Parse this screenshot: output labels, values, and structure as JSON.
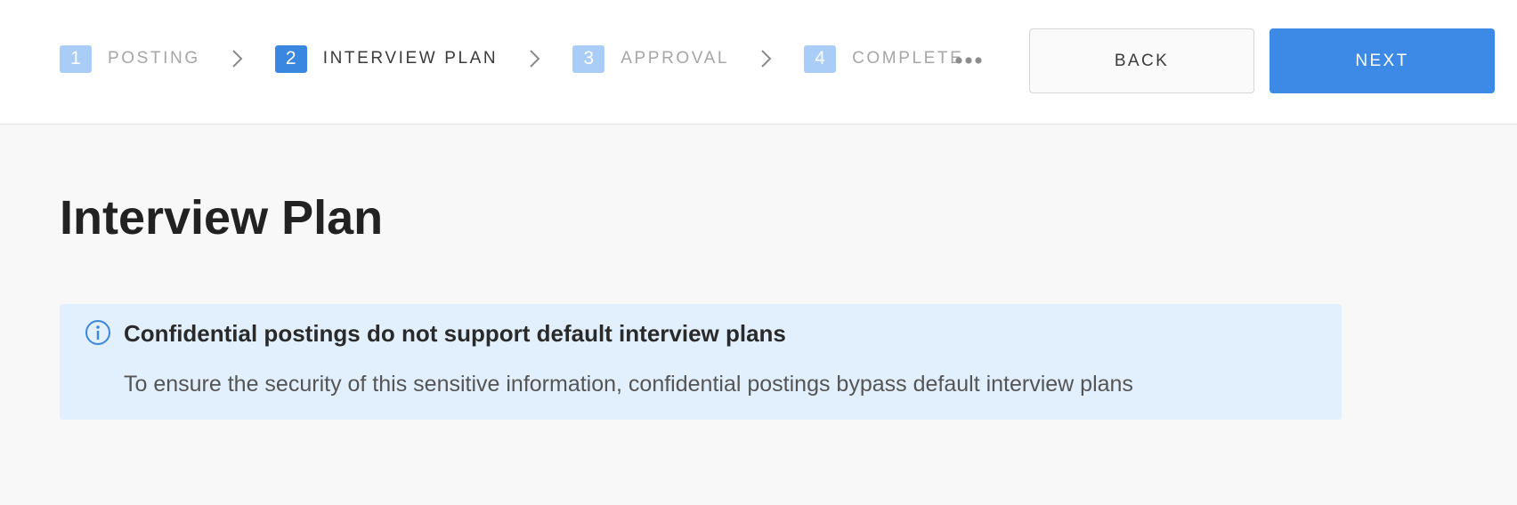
{
  "stepper": {
    "steps": [
      {
        "number": "1",
        "label": "POSTING"
      },
      {
        "number": "2",
        "label": "INTERVIEW PLAN"
      },
      {
        "number": "3",
        "label": "APPROVAL"
      },
      {
        "number": "4",
        "label": "COMPLETE"
      }
    ],
    "active_step": "2"
  },
  "toolbar": {
    "more_icon": "more-horizontal-icon",
    "back_label": "BACK",
    "next_label": "NEXT"
  },
  "page": {
    "title": "Interview Plan"
  },
  "notice": {
    "icon": "info-icon",
    "title": "Confidential postings do not support default interview plans",
    "body": "To ensure the security of this sensitive information, confidential postings bypass default interview plans"
  },
  "colors": {
    "accent": "#3d8ae6",
    "step_inactive": "#a9cdf6",
    "notice_bg": "#e2effc",
    "page_bg": "#f8f8f8"
  }
}
